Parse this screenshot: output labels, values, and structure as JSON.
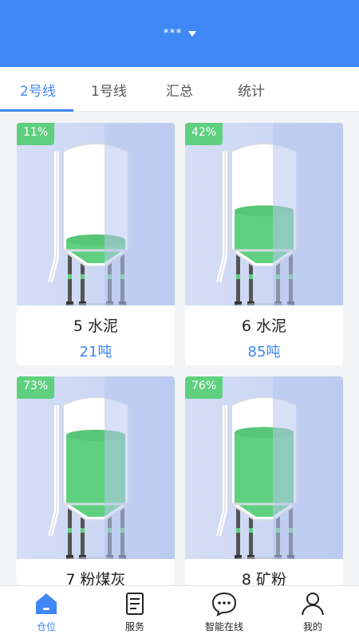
{
  "header": {
    "top_glyphs": "' '",
    "station": "***"
  },
  "tabs": [
    {
      "label": "2号线",
      "active": true
    },
    {
      "label": "1号线",
      "active": false
    },
    {
      "label": "汇总",
      "active": false
    },
    {
      "label": "统计",
      "active": false
    }
  ],
  "silos": [
    {
      "name": "5 水泥",
      "amount": "21吨",
      "percent": "11%",
      "fill": 0.11
    },
    {
      "name": "6 水泥",
      "amount": "85吨",
      "percent": "42%",
      "fill": 0.42
    },
    {
      "name": "7 粉煤灰",
      "amount": "",
      "percent": "73%",
      "fill": 0.73
    },
    {
      "name": "8 矿粉",
      "amount": "",
      "percent": "76%",
      "fill": 0.76
    }
  ],
  "tabbar": [
    {
      "label": "仓位",
      "icon": "home-icon",
      "active": true
    },
    {
      "label": "服务",
      "icon": "service-icon",
      "active": false
    },
    {
      "label": "智能在线",
      "icon": "chat-icon",
      "active": false
    },
    {
      "label": "我的",
      "icon": "user-icon",
      "active": false
    }
  ],
  "colors": {
    "primary": "#3f87f5",
    "fill_green": "#5fd07f",
    "badge_green": "#5fd07f"
  }
}
